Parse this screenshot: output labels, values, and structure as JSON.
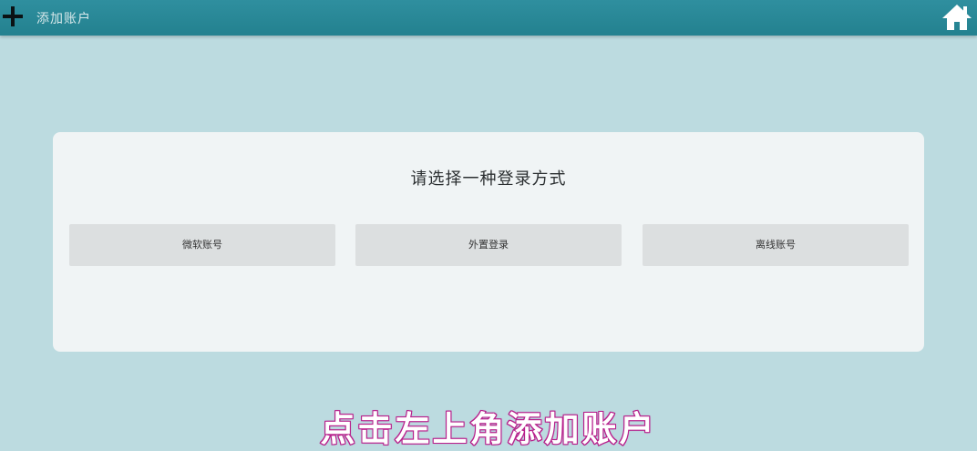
{
  "header": {
    "title": "添加账户",
    "add_icon": "plus-icon",
    "home_icon": "home-icon"
  },
  "dialog": {
    "title": "请选择一种登录方式",
    "options": [
      {
        "label": "微软账号"
      },
      {
        "label": "外置登录"
      },
      {
        "label": "离线账号"
      }
    ]
  },
  "caption": "点击左上角添加账户",
  "colors": {
    "topbar": "#23818f",
    "background": "#bcdbe0",
    "card": "#f0f4f5",
    "button": "#dcdfe0",
    "caption_stroke": "#a0187a"
  }
}
